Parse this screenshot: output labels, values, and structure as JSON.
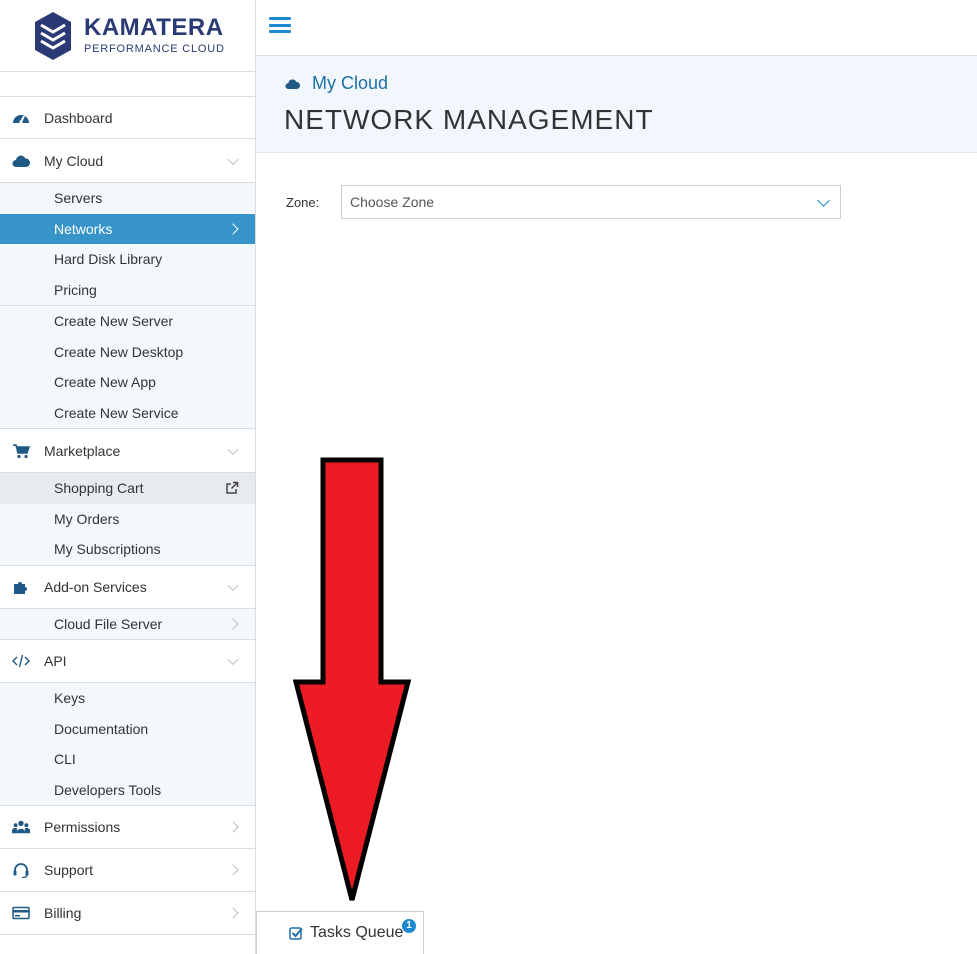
{
  "brand": {
    "name": "KAMATERA",
    "tagline": "PERFORMANCE CLOUD",
    "color": "#2a3a74"
  },
  "sidebar": {
    "dashboard": "Dashboard",
    "my_cloud": {
      "label": "My Cloud",
      "items": [
        "Servers",
        "Networks",
        "Hard Disk Library",
        "Pricing"
      ],
      "create": [
        "Create New Server",
        "Create New Desktop",
        "Create New App",
        "Create New Service"
      ]
    },
    "marketplace": {
      "label": "Marketplace",
      "items": [
        "Shopping Cart",
        "My Orders",
        "My Subscriptions"
      ]
    },
    "addons": {
      "label": "Add-on Services",
      "items": [
        "Cloud File Server"
      ]
    },
    "api": {
      "label": "API",
      "items": [
        "Keys",
        "Documentation",
        "CLI",
        "Developers Tools"
      ]
    },
    "permissions": "Permissions",
    "support": "Support",
    "billing": "Billing",
    "active_item": "Networks",
    "active_color": "#3694c9"
  },
  "header": {
    "breadcrumb": "My Cloud",
    "title": "NETWORK MANAGEMENT"
  },
  "zone": {
    "label": "Zone:",
    "placeholder": "Choose Zone"
  },
  "tasks": {
    "label": "Tasks Queue",
    "count": "1"
  },
  "annotation": {
    "type": "down-arrow",
    "fill": "#ed1c24"
  }
}
